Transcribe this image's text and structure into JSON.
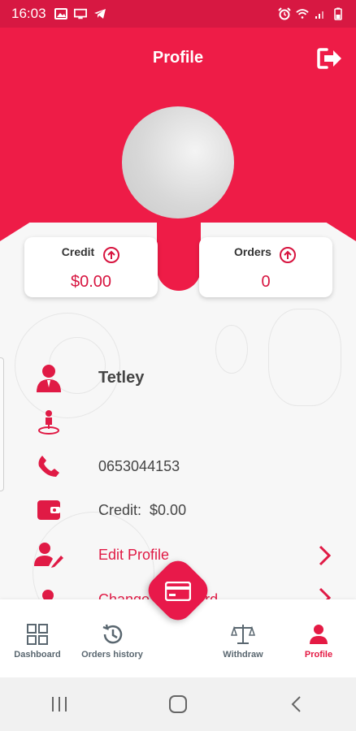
{
  "status_bar": {
    "time": "16:03",
    "left_icons": [
      "image-icon",
      "cast-icon",
      "telegram-icon"
    ],
    "right_icons": [
      "alarm-icon",
      "wifi-icon",
      "signal-icon",
      "battery-icon"
    ]
  },
  "header": {
    "title": "Profile",
    "logout_icon": "logout-icon",
    "color": "#ee1c47"
  },
  "stats": {
    "credit": {
      "label": "Credit",
      "value": "$0.00",
      "icon": "arrow-up-circle-icon"
    },
    "orders": {
      "label": "Orders",
      "value": "0",
      "icon": "arrow-up-circle-icon"
    }
  },
  "profile": {
    "name": "Tetley",
    "location": "",
    "phone": "0653044153",
    "credit_label": "Credit:",
    "credit_value": "$0.00",
    "edit_profile": "Edit Profile",
    "change_password": "Change Password"
  },
  "bottom_nav": {
    "items": [
      {
        "label": "Dashboard",
        "icon": "dashboard-icon",
        "active": false
      },
      {
        "label": "Orders history",
        "icon": "history-icon",
        "active": false
      },
      {
        "label": "Withdraw",
        "icon": "scale-icon",
        "active": false
      },
      {
        "label": "Profile",
        "icon": "person-icon",
        "active": true
      }
    ],
    "fab_icon": "card-icon",
    "accent": "#e41a44"
  },
  "system_nav": [
    "recents-icon",
    "home-icon",
    "back-icon"
  ]
}
